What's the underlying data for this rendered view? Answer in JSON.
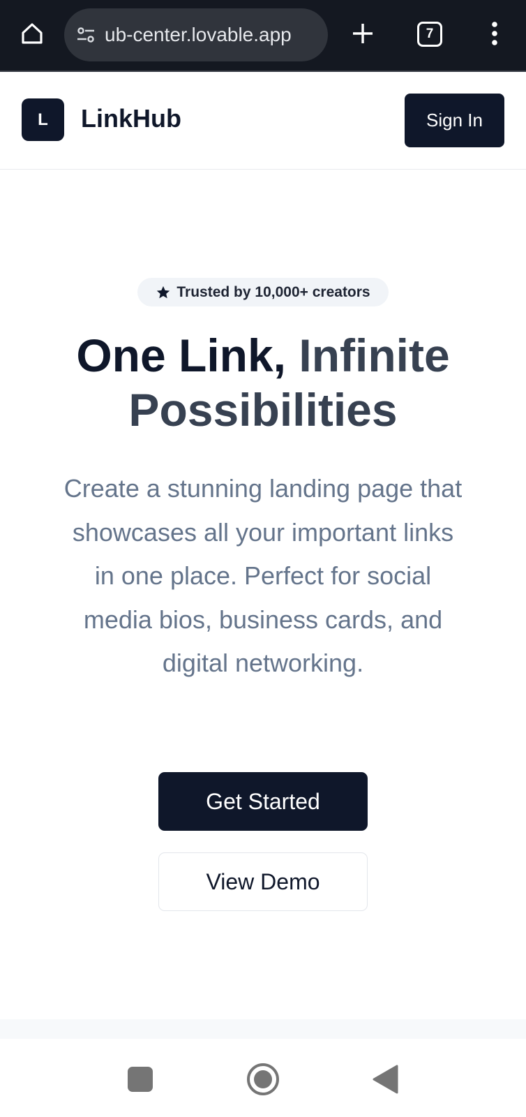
{
  "browser": {
    "url": "ub-center.lovable.app",
    "tab_count": "7",
    "icons": [
      "home-icon",
      "site-settings-icon",
      "new-tab-icon",
      "tab-switcher-icon",
      "menu-icon"
    ]
  },
  "header": {
    "logo_letter": "L",
    "brand": "LinkHub",
    "sign_in_label": "Sign In"
  },
  "hero": {
    "badge_text": "Trusted by 10,000+ creators",
    "headline_line1_dark": "One Link, ",
    "headline_line1_muted": "Infinite",
    "headline_line2": "Possibilities",
    "description": "Create a stunning landing page that showcases all your important links in one place. Perfect for social media bios, business cards, and digital networking.",
    "primary_cta": "Get Started",
    "secondary_cta": "View Demo"
  },
  "colors": {
    "brand_dark": "#0f172a",
    "muted_text": "#64748b",
    "badge_bg": "#f1f4f8"
  }
}
